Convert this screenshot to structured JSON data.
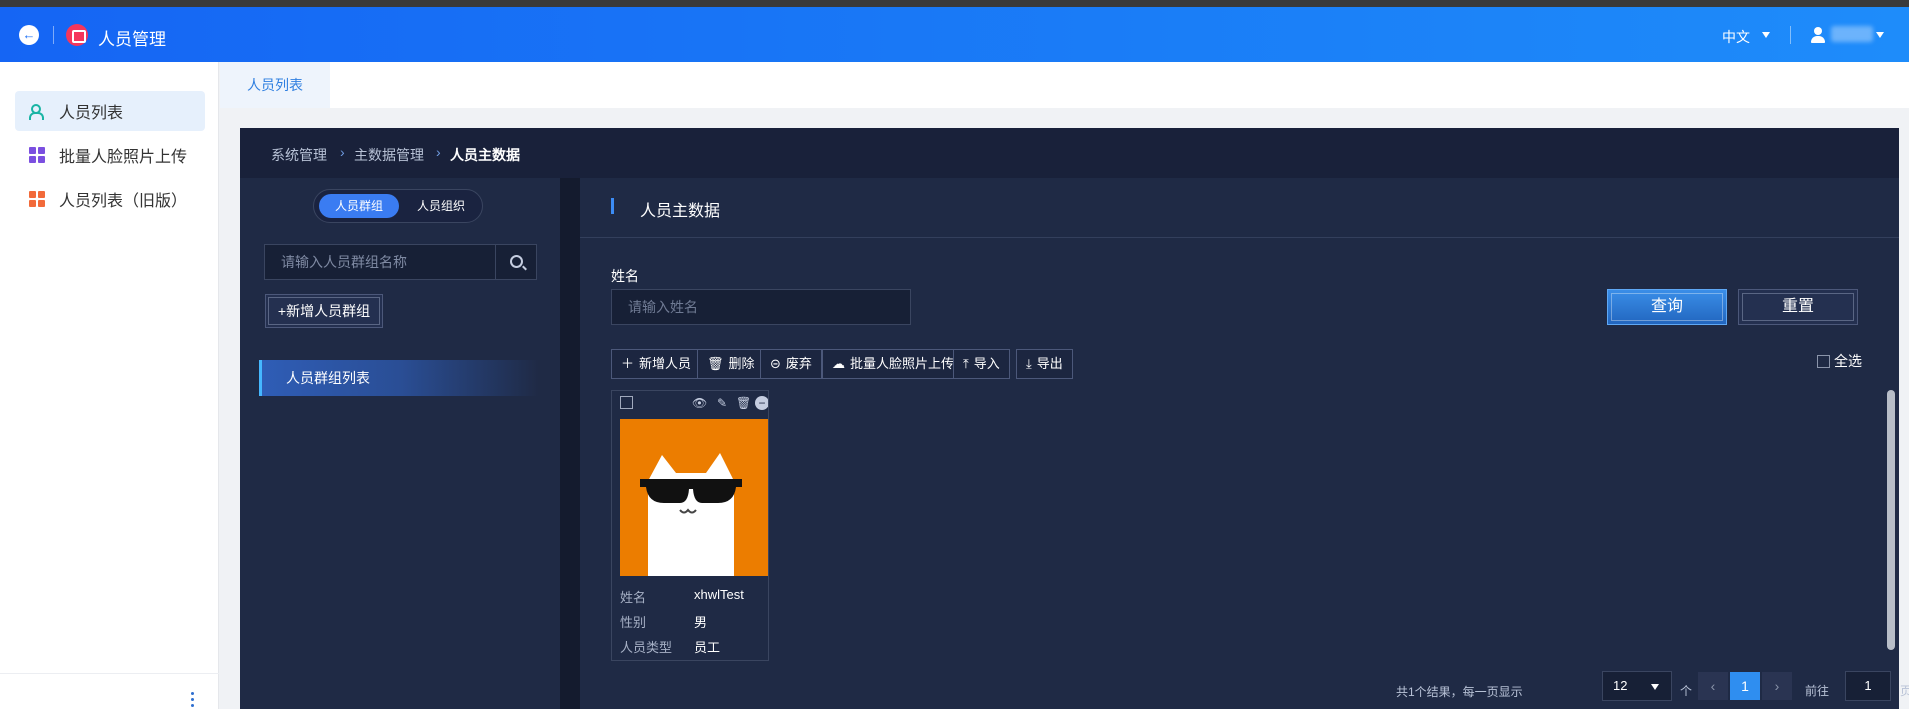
{
  "header": {
    "app_title": "人员管理",
    "language": "中文"
  },
  "sidebar": {
    "items": [
      {
        "label": "人员列表",
        "active": true
      },
      {
        "label": "批量人脸照片上传",
        "active": false
      },
      {
        "label": "人员列表（旧版）",
        "active": false
      }
    ]
  },
  "tabs": [
    {
      "label": "人员列表"
    }
  ],
  "breadcrumb": [
    "系统管理",
    "主数据管理",
    "人员主数据"
  ],
  "left_panel": {
    "segments": [
      "人员群组",
      "人员组织"
    ],
    "search_placeholder": "请输入人员群组名称",
    "add_group_label": "+新增人员群组",
    "group_list_label": "人员群组列表"
  },
  "main": {
    "section_title": "人员主数据",
    "name_label": "姓名",
    "name_placeholder": "请输入姓名",
    "query_label": "查询",
    "reset_label": "重置",
    "toolbar": {
      "add": "新增人员",
      "delete": "删除",
      "discard": "废弃",
      "batch_upload": "批量人脸照片上传",
      "import": "导入",
      "export": "导出"
    },
    "select_all": "全选",
    "card": {
      "fields": [
        {
          "label": "姓名",
          "value": "xhwlTest"
        },
        {
          "label": "性别",
          "value": "男"
        },
        {
          "label": "人员类型",
          "value": "员工"
        }
      ]
    },
    "pagination": {
      "total_text": "共1个结果，每一页显示",
      "page_size": "12",
      "unit": "个",
      "current_page": "1",
      "goto_label": "前往",
      "goto_value": "1",
      "page_suffix": "页"
    }
  },
  "colors": {
    "header": "#1a7df7",
    "accent": "#2f8ef0",
    "panel": "#1f2a45",
    "photo_bg": "#ec7d00"
  }
}
